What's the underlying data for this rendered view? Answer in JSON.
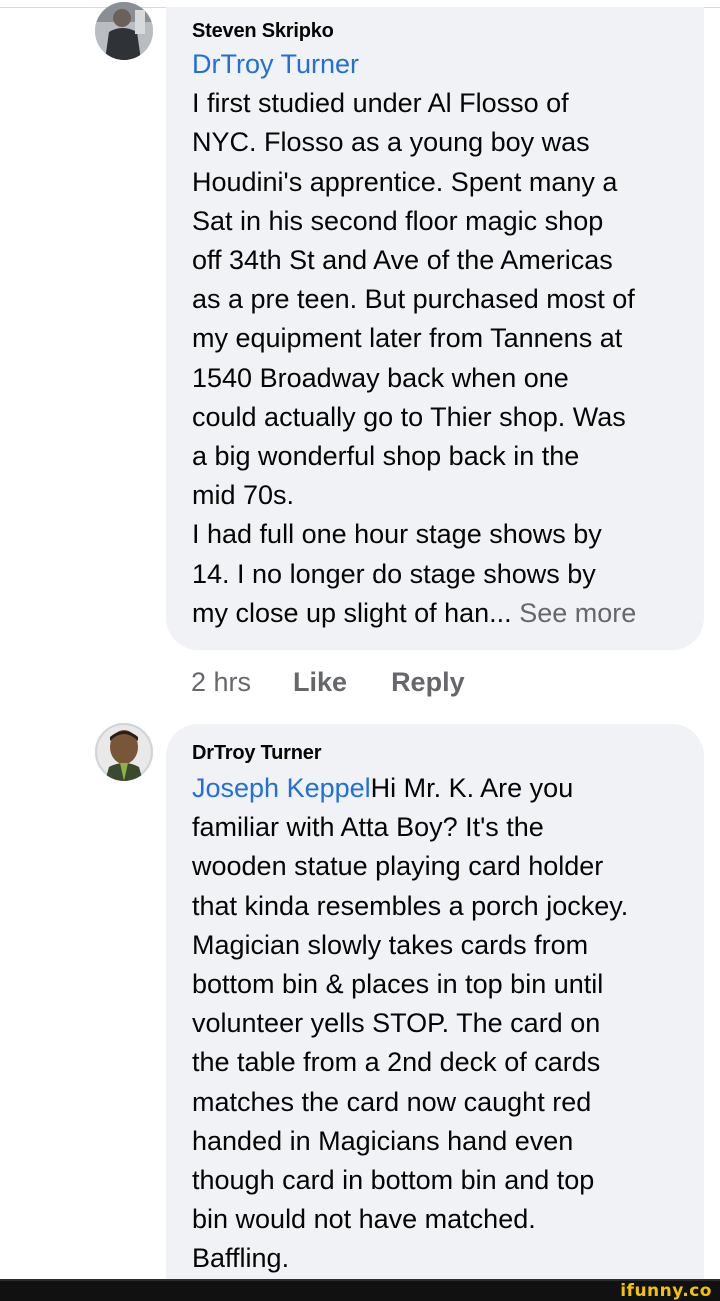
{
  "comments": [
    {
      "author": "Steven Skripko",
      "mention": "DrTroy Turner",
      "lines": [
        "I first studied under Al Flosso of",
        "NYC. Flosso as a young boy was",
        "Houdini's apprentice. Spent many a",
        "Sat in his second floor magic shop",
        "off 34th St and Ave of the Americas",
        "as a pre teen. But purchased most of",
        "my equipment later from Tannens at",
        "1540 Broadway back when one",
        "could actually go to Thier shop. Was",
        "a big wonderful shop back in the",
        "mid 70s.",
        "I had full one hour stage shows by",
        "14.  I no longer do stage shows by"
      ],
      "last_line": "my close up slight of han...",
      "see_more": "See more",
      "time": "2 hrs",
      "like": "Like",
      "reply": "Reply"
    },
    {
      "author": "DrTroy Turner",
      "mention": "Joseph Keppel",
      "first_line_rest": "Hi Mr. K. Are you",
      "lines": [
        "familiar with Atta Boy? It's the",
        "wooden statue playing card holder",
        "that kinda resembles a porch jockey.",
        "Magician slowly takes cards from",
        "bottom bin  & places in top bin until",
        "volunteer yells STOP. The card on",
        "the table from a 2nd deck of cards",
        "matches the card now caught red",
        "handed in Magicians hand even",
        "though  card in bottom bin and top",
        "bin would not have matched.",
        "Baffling."
      ]
    }
  ],
  "watermark": "ifunny.co",
  "colors": {
    "bubble": "#f0f2f5",
    "mention": "#216fdb",
    "secondary_text": "#65676b",
    "watermark": "#f5c400"
  }
}
